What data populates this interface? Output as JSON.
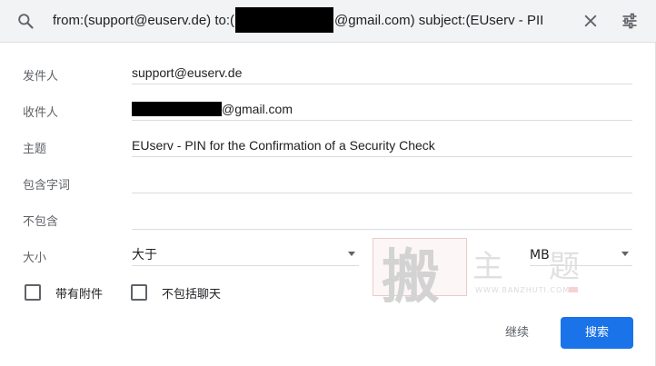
{
  "search_bar": {
    "query_prefix": "from:(support@euserv.de) to:(",
    "query_suffix": "@gmail.com) subject:(EUserv - PII"
  },
  "form": {
    "from": {
      "label": "发件人",
      "value": "support@euserv.de"
    },
    "to": {
      "label": "收件人",
      "value_suffix": "@gmail.com"
    },
    "subject": {
      "label": "主题",
      "value": "EUserv - PIN for the Confirmation of a Security Check"
    },
    "has_words": {
      "label": "包含字词",
      "value": ""
    },
    "doesnt_have": {
      "label": "不包含",
      "value": ""
    },
    "size": {
      "label": "大小",
      "comparator": "大于",
      "unit": "MB"
    }
  },
  "checkboxes": {
    "has_attachment": {
      "label": "带有附件",
      "checked": false
    },
    "exclude_chats": {
      "label": "不包括聊天",
      "checked": false
    }
  },
  "buttons": {
    "continue": "继续",
    "search": "搜索"
  },
  "watermark": {
    "char1": "搬",
    "char2": "主",
    "char3": "题",
    "url": "WWW.BANZHUTI.COM"
  },
  "colors": {
    "accent": "#1a73e8",
    "topbar_bg": "#f1f3f4",
    "label_gray": "#5f6368"
  },
  "icons": [
    "search-icon",
    "close-icon",
    "tune-icon",
    "chevron-down-icon"
  ]
}
